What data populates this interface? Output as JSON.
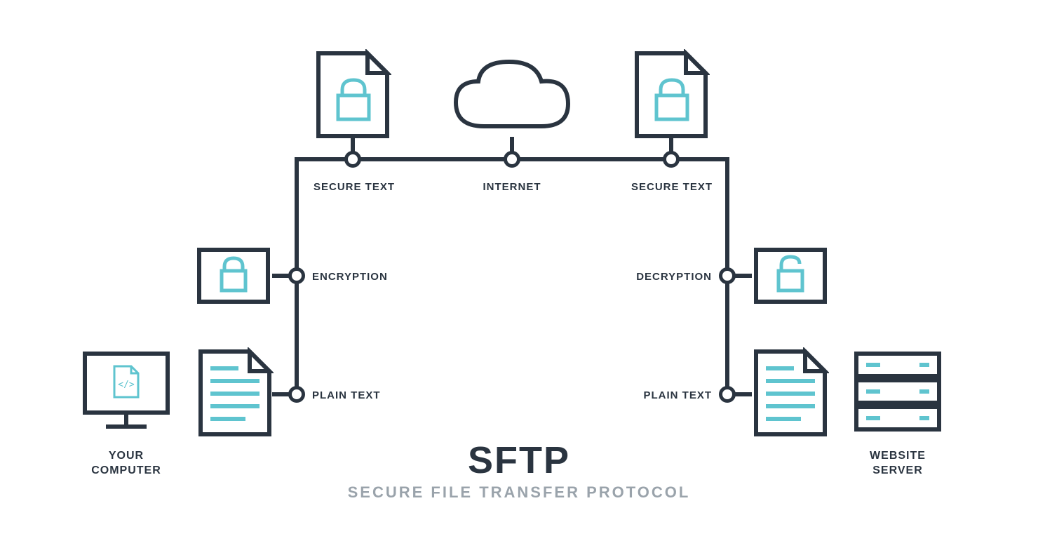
{
  "title": {
    "main": "SFTP",
    "sub": "SECURE FILE TRANSFER PROTOCOL"
  },
  "labels": {
    "your_computer": "YOUR\nCOMPUTER",
    "website_server": "WEBSITE\nSERVER",
    "plain_text_left": "PLAIN TEXT",
    "plain_text_right": "PLAIN TEXT",
    "encryption": "ENCRYPTION",
    "decryption": "DECRYPTION",
    "secure_text_left": "SECURE TEXT",
    "secure_text_right": "SECURE TEXT",
    "internet": "INTERNET"
  },
  "colors": {
    "dark": "#2A3440",
    "teal": "#5FC4CF",
    "grey": "#9AA3AB"
  }
}
